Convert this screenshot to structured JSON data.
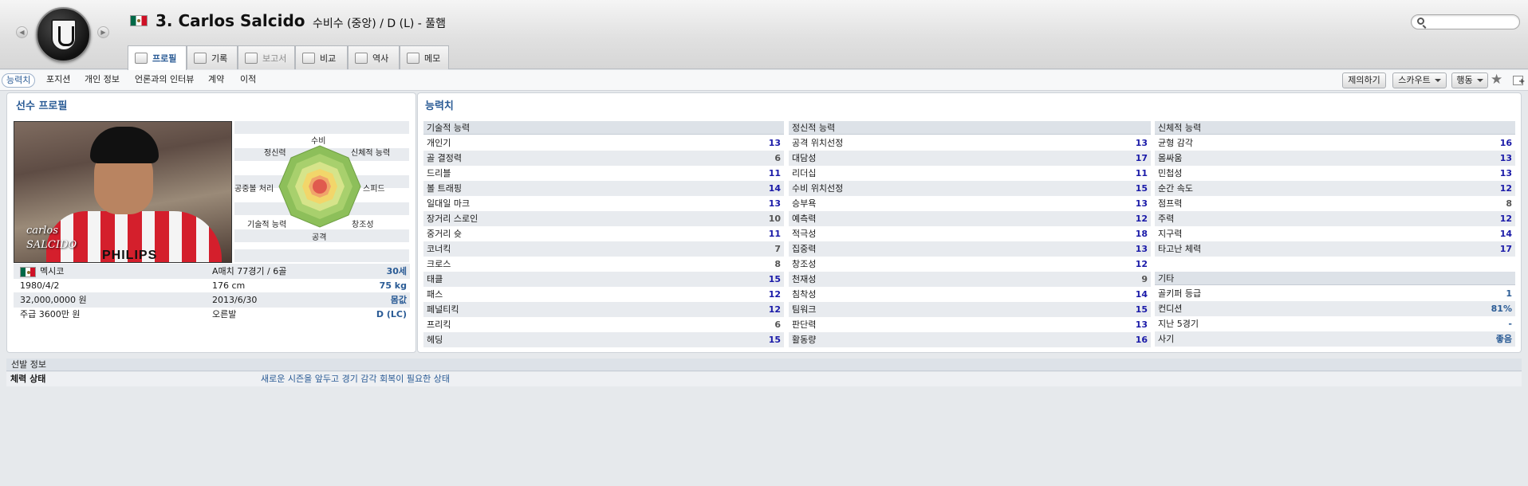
{
  "header": {
    "player_title": "3. Carlos Salcido",
    "player_subtitle": "수비수 (중앙) / D (L) - 풀햄",
    "search_placeholder": ""
  },
  "tabs": [
    {
      "label": "프로필",
      "icon": "profile-card-icon",
      "active": true
    },
    {
      "label": "기록",
      "icon": "bar-chart-icon"
    },
    {
      "label": "보고서",
      "icon": "report-icon",
      "disabled": true
    },
    {
      "label": "비교",
      "icon": "compare-icon"
    },
    {
      "label": "역사",
      "icon": "history-icon"
    },
    {
      "label": "메모",
      "icon": "note-icon"
    }
  ],
  "subnav": {
    "items": [
      "능력치",
      "포지션",
      "개인 정보",
      "언론과의 인터뷰",
      "계약",
      "이적"
    ],
    "offer_button": "제의하기",
    "scout_button": "스카우트",
    "action_button": "행동"
  },
  "profile": {
    "title": "선수 프로필",
    "photo_signature_line1": "carlos",
    "photo_signature_line2": "SALCIDO",
    "photo_sponsor": "PHILIPS",
    "radar_labels": {
      "top": "수비",
      "top_left": "정신력",
      "top_right": "신체적 능력",
      "left": "공중볼 처리",
      "right": "스피드",
      "bottom_left": "기술적 능력",
      "bottom_right": "창조성",
      "bottom": "공격"
    },
    "rows": [
      [
        "멕시코",
        "A매치 77경기 / 6골",
        "30세"
      ],
      [
        "1980/4/2",
        "176 cm",
        "75 kg"
      ],
      [
        "32,000,0000 원",
        "2013/6/30",
        "몸값"
      ],
      [
        "주급 3600만 원",
        "오른발",
        "D (LC)"
      ]
    ]
  },
  "attributes": {
    "title": "능력치",
    "technical": {
      "header": "기술적 능력",
      "items": [
        [
          "개인기",
          "13"
        ],
        [
          "골 결정력",
          "6"
        ],
        [
          "드리블",
          "11"
        ],
        [
          "볼 트래핑",
          "14"
        ],
        [
          "일대일 마크",
          "13"
        ],
        [
          "장거리 스로인",
          "10"
        ],
        [
          "중거리 슛",
          "11"
        ],
        [
          "코너킥",
          "7"
        ],
        [
          "크로스",
          "8"
        ],
        [
          "태클",
          "15"
        ],
        [
          "패스",
          "12"
        ],
        [
          "페널티킥",
          "12"
        ],
        [
          "프리킥",
          "6"
        ],
        [
          "헤딩",
          "15"
        ]
      ]
    },
    "mental": {
      "header": "정신적 능력",
      "items": [
        [
          "공격 위치선정",
          "13"
        ],
        [
          "대담성",
          "17"
        ],
        [
          "리더십",
          "11"
        ],
        [
          "수비 위치선정",
          "15"
        ],
        [
          "승부욕",
          "13"
        ],
        [
          "예측력",
          "12"
        ],
        [
          "적극성",
          "18"
        ],
        [
          "집중력",
          "13"
        ],
        [
          "창조성",
          "12"
        ],
        [
          "천재성",
          "9"
        ],
        [
          "침착성",
          "14"
        ],
        [
          "팀워크",
          "15"
        ],
        [
          "판단력",
          "13"
        ],
        [
          "활동량",
          "16"
        ]
      ]
    },
    "physical": {
      "header": "신체적 능력",
      "items": [
        [
          "균형 감각",
          "16"
        ],
        [
          "몸싸움",
          "13"
        ],
        [
          "민첩성",
          "13"
        ],
        [
          "순간 속도",
          "12"
        ],
        [
          "점프력",
          "8"
        ],
        [
          "주력",
          "12"
        ],
        [
          "지구력",
          "14"
        ],
        [
          "타고난 체력",
          "17"
        ]
      ]
    },
    "other": {
      "header": "기타",
      "items": [
        [
          "골키퍼 등급",
          "1"
        ],
        [
          "컨디션",
          "81%"
        ],
        [
          "지난 5경기",
          "-"
        ],
        [
          "사기",
          "좋음"
        ]
      ]
    }
  },
  "selection": {
    "header": "선발 정보",
    "label": "체력 상태",
    "value": "새로운 시즌을 앞두고 경기 감각 회복이 필요한 상태"
  },
  "colors": {
    "link_blue": "#2a5b95",
    "value_high": "#1a1aa8",
    "value_normal": "#555555",
    "radar_outer": "#8dbf5a",
    "radar_inner": "#e05a4e"
  }
}
